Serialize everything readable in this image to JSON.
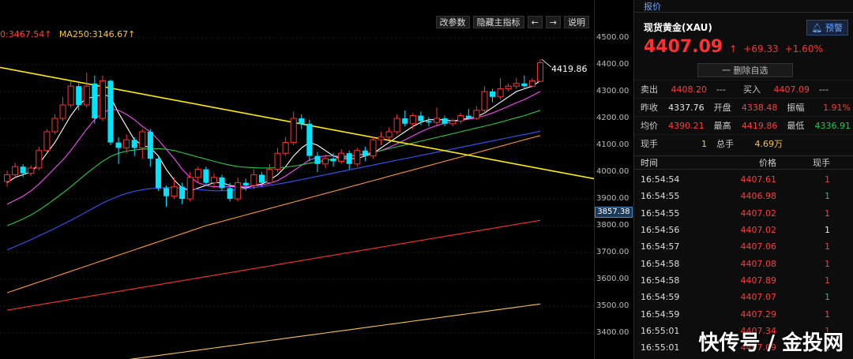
{
  "chart": {
    "ma_legend": [
      {
        "label": "0:3467.54↑",
        "color": "#ff4040"
      },
      {
        "label": "MA250:3146.67↑",
        "color": "#f5c542"
      }
    ],
    "toolbar": {
      "edit_params": "改参数",
      "hide_main": "隐藏主指标",
      "prev": "←",
      "next": "→",
      "help": "说明"
    },
    "high_label": "4419.86",
    "current_price_tag": "3857.38",
    "axis_ticks": [
      "4500.00",
      "4400.00",
      "4300.00",
      "4200.00",
      "4100.00",
      "4000.00",
      "3900.00",
      "3800.00",
      "3700.00",
      "3600.00",
      "3500.00",
      "3400.00"
    ]
  },
  "chart_data": {
    "type": "candlestick",
    "y_range": [
      3360,
      4520
    ],
    "candles": [
      {
        "o": 3965,
        "c": 3990,
        "h": 4005,
        "l": 3945
      },
      {
        "o": 3990,
        "c": 4020,
        "h": 4035,
        "l": 3975
      },
      {
        "o": 4020,
        "c": 3995,
        "h": 4030,
        "l": 3980
      },
      {
        "o": 3995,
        "c": 4015,
        "h": 4025,
        "l": 3985
      },
      {
        "o": 4015,
        "c": 4080,
        "h": 4095,
        "l": 4005
      },
      {
        "o": 4080,
        "c": 4150,
        "h": 4160,
        "l": 4070
      },
      {
        "o": 4150,
        "c": 4200,
        "h": 4215,
        "l": 4140
      },
      {
        "o": 4200,
        "c": 4250,
        "h": 4280,
        "l": 4190
      },
      {
        "o": 4250,
        "c": 4320,
        "h": 4340,
        "l": 4240
      },
      {
        "o": 4320,
        "c": 4250,
        "h": 4330,
        "l": 4230
      },
      {
        "o": 4250,
        "c": 4320,
        "h": 4370,
        "l": 4240
      },
      {
        "o": 4330,
        "c": 4200,
        "h": 4360,
        "l": 4180
      },
      {
        "o": 4200,
        "c": 4340,
        "h": 4360,
        "l": 4190
      },
      {
        "o": 4340,
        "c": 4110,
        "h": 4345,
        "l": 4100
      },
      {
        "o": 4110,
        "c": 4090,
        "h": 4130,
        "l": 4030
      },
      {
        "o": 4090,
        "c": 4120,
        "h": 4140,
        "l": 4070
      },
      {
        "o": 4120,
        "c": 4090,
        "h": 4130,
        "l": 4060
      },
      {
        "o": 4090,
        "c": 4150,
        "h": 4160,
        "l": 4050
      },
      {
        "o": 4150,
        "c": 4050,
        "h": 4160,
        "l": 4020
      },
      {
        "o": 4050,
        "c": 3940,
        "h": 4060,
        "l": 3930
      },
      {
        "o": 3940,
        "c": 3910,
        "h": 3950,
        "l": 3870
      },
      {
        "o": 3910,
        "c": 3945,
        "h": 3980,
        "l": 3900
      },
      {
        "o": 3945,
        "c": 3900,
        "h": 3960,
        "l": 3880
      },
      {
        "o": 3900,
        "c": 3980,
        "h": 4000,
        "l": 3890
      },
      {
        "o": 3980,
        "c": 4010,
        "h": 4020,
        "l": 3960
      },
      {
        "o": 4010,
        "c": 3960,
        "h": 4020,
        "l": 3950
      },
      {
        "o": 3960,
        "c": 3980,
        "h": 3995,
        "l": 3940
      },
      {
        "o": 3980,
        "c": 3940,
        "h": 3990,
        "l": 3930
      },
      {
        "o": 3940,
        "c": 3900,
        "h": 3960,
        "l": 3890
      },
      {
        "o": 3900,
        "c": 3960,
        "h": 3980,
        "l": 3890
      },
      {
        "o": 3960,
        "c": 3950,
        "h": 3975,
        "l": 3930
      },
      {
        "o": 3950,
        "c": 3990,
        "h": 4010,
        "l": 3935
      },
      {
        "o": 3990,
        "c": 3960,
        "h": 4000,
        "l": 3945
      },
      {
        "o": 3960,
        "c": 4010,
        "h": 4030,
        "l": 3955
      },
      {
        "o": 4010,
        "c": 4070,
        "h": 4090,
        "l": 4000
      },
      {
        "o": 4070,
        "c": 4110,
        "h": 4130,
        "l": 4060
      },
      {
        "o": 4110,
        "c": 4200,
        "h": 4225,
        "l": 4100
      },
      {
        "o": 4200,
        "c": 4180,
        "h": 4215,
        "l": 4160
      },
      {
        "o": 4180,
        "c": 4060,
        "h": 4195,
        "l": 4040
      },
      {
        "o": 4060,
        "c": 4030,
        "h": 4075,
        "l": 4000
      },
      {
        "o": 4030,
        "c": 4050,
        "h": 4065,
        "l": 4015
      },
      {
        "o": 4050,
        "c": 4040,
        "h": 4070,
        "l": 4020
      },
      {
        "o": 4040,
        "c": 4070,
        "h": 4085,
        "l": 4030
      },
      {
        "o": 4070,
        "c": 4030,
        "h": 4080,
        "l": 4010
      },
      {
        "o": 4030,
        "c": 4080,
        "h": 4090,
        "l": 4020
      },
      {
        "o": 4080,
        "c": 4060,
        "h": 4095,
        "l": 4040
      },
      {
        "o": 4060,
        "c": 4120,
        "h": 4130,
        "l": 4050
      },
      {
        "o": 4120,
        "c": 4130,
        "h": 4150,
        "l": 4100
      },
      {
        "o": 4130,
        "c": 4150,
        "h": 4165,
        "l": 4120
      },
      {
        "o": 4150,
        "c": 4200,
        "h": 4215,
        "l": 4140
      },
      {
        "o": 4200,
        "c": 4180,
        "h": 4230,
        "l": 4170
      },
      {
        "o": 4180,
        "c": 4210,
        "h": 4220,
        "l": 4160
      },
      {
        "o": 4210,
        "c": 4190,
        "h": 4225,
        "l": 4175
      },
      {
        "o": 4190,
        "c": 4185,
        "h": 4205,
        "l": 4170
      },
      {
        "o": 4185,
        "c": 4200,
        "h": 4240,
        "l": 4175
      },
      {
        "o": 4200,
        "c": 4180,
        "h": 4210,
        "l": 4170
      },
      {
        "o": 4180,
        "c": 4190,
        "h": 4200,
        "l": 4170
      },
      {
        "o": 4190,
        "c": 4210,
        "h": 4220,
        "l": 4180
      },
      {
        "o": 4210,
        "c": 4200,
        "h": 4235,
        "l": 4195
      },
      {
        "o": 4200,
        "c": 4230,
        "h": 4245,
        "l": 4195
      },
      {
        "o": 4230,
        "c": 4300,
        "h": 4320,
        "l": 4220
      },
      {
        "o": 4300,
        "c": 4280,
        "h": 4310,
        "l": 4260
      },
      {
        "o": 4280,
        "c": 4310,
        "h": 4350,
        "l": 4270
      },
      {
        "o": 4310,
        "c": 4320,
        "h": 4330,
        "l": 4300
      },
      {
        "o": 4320,
        "c": 4330,
        "h": 4350,
        "l": 4310
      },
      {
        "o": 4330,
        "c": 4320,
        "h": 4360,
        "l": 4310
      },
      {
        "o": 4320,
        "c": 4340,
        "h": 4350,
        "l": 4315
      },
      {
        "o": 4338,
        "c": 4407,
        "h": 4420,
        "l": 4337
      }
    ],
    "ma_lines": [
      {
        "name": "MA5",
        "color": "#ffffff",
        "values": [
          3960,
          3980,
          3990,
          4000,
          4030,
          4070,
          4110,
          4160,
          4210,
          4250,
          4275,
          4280,
          4290,
          4280,
          4220,
          4170,
          4120,
          4100,
          4090,
          4060,
          4010,
          3970,
          3940,
          3930,
          3940,
          3950,
          3960,
          3960,
          3950,
          3945,
          3940,
          3950,
          3955,
          3970,
          3990,
          4020,
          4060,
          4090,
          4110,
          4100,
          4080,
          4060,
          4050,
          4050,
          4050,
          4060,
          4070,
          4090,
          4110,
          4130,
          4150,
          4170,
          4185,
          4195,
          4195,
          4195,
          4190,
          4195,
          4200,
          4205,
          4220,
          4240,
          4260,
          4280,
          4300,
          4310,
          4320,
          4340
        ]
      },
      {
        "name": "MA10",
        "color": "#ff44ff",
        "values": [
          3880,
          3895,
          3910,
          3930,
          3955,
          3985,
          4015,
          4045,
          4080,
          4120,
          4160,
          4195,
          4220,
          4235,
          4230,
          4215,
          4195,
          4170,
          4150,
          4120,
          4085,
          4050,
          4010,
          3980,
          3960,
          3950,
          3945,
          3945,
          3945,
          3945,
          3945,
          3948,
          3952,
          3958,
          3968,
          3985,
          4005,
          4025,
          4045,
          4055,
          4060,
          4060,
          4058,
          4060,
          4062,
          4066,
          4072,
          4080,
          4092,
          4105,
          4120,
          4135,
          4150,
          4163,
          4173,
          4182,
          4188,
          4192,
          4197,
          4202,
          4210,
          4220,
          4232,
          4245,
          4258,
          4270,
          4285,
          4300
        ]
      },
      {
        "name": "MA20",
        "color": "#22cc44",
        "values": [
          3800,
          3812,
          3825,
          3840,
          3858,
          3878,
          3900,
          3922,
          3945,
          3970,
          3995,
          4018,
          4040,
          4058,
          4070,
          4078,
          4082,
          4085,
          4087,
          4087,
          4085,
          4080,
          4072,
          4064,
          4056,
          4048,
          4040,
          4032,
          4026,
          4020,
          4018,
          4016,
          4015,
          4015,
          4016,
          4018,
          4022,
          4027,
          4033,
          4038,
          4043,
          4048,
          4053,
          4058,
          4063,
          4068,
          4074,
          4080,
          4087,
          4094,
          4101,
          4108,
          4115,
          4122,
          4129,
          4136,
          4143,
          4150,
          4157,
          4164,
          4171,
          4178,
          4186,
          4194,
          4202,
          4210,
          4220,
          4230
        ]
      },
      {
        "name": "MA30",
        "color": "#3355ff",
        "values": [
          3710,
          3722,
          3735,
          3748,
          3762,
          3776,
          3790,
          3805,
          3820,
          3836,
          3852,
          3868,
          3884,
          3898,
          3910,
          3920,
          3928,
          3934,
          3938,
          3940,
          3942,
          3942,
          3940,
          3938,
          3935,
          3932,
          3930,
          3930,
          3932,
          3935,
          3938,
          3942,
          3946,
          3950,
          3955,
          3960,
          3966,
          3972,
          3978,
          3984,
          3990,
          3996,
          4002,
          4008,
          4014,
          4020,
          4026,
          4032,
          4038,
          4044,
          4050,
          4056,
          4062,
          4068,
          4074,
          4080,
          4086,
          4092,
          4098,
          4104,
          4110,
          4116,
          4122,
          4128,
          4134,
          4140,
          4146,
          4152
        ]
      },
      {
        "name": "MA60",
        "color": "#ff9922",
        "values": [
          3550,
          3560,
          3570,
          3580,
          3590,
          3600,
          3610,
          3620,
          3630,
          3640,
          3650,
          3660,
          3670,
          3680,
          3690,
          3700,
          3710,
          3720,
          3730,
          3740,
          3750,
          3760,
          3770,
          3780,
          3790,
          3800,
          3808,
          3816,
          3824,
          3832,
          3840,
          3848,
          3856,
          3864,
          3872,
          3880,
          3888,
          3896,
          3904,
          3912,
          3920,
          3928,
          3936,
          3944,
          3952,
          3960,
          3968,
          3976,
          3984,
          3992,
          4000,
          4008,
          4016,
          4024,
          4032,
          4040,
          4048,
          4056,
          4064,
          4072,
          4080,
          4088,
          4096,
          4104,
          4112,
          4120,
          4128,
          4136
        ]
      },
      {
        "name": "MA120",
        "color": "#ff3030",
        "values": [
          3485,
          3490,
          3495,
          3500,
          3505,
          3510,
          3515,
          3520,
          3525,
          3530,
          3535,
          3540,
          3545,
          3550,
          3555,
          3560,
          3565,
          3570,
          3575,
          3580,
          3585,
          3590,
          3595,
          3600,
          3605,
          3610,
          3615,
          3620,
          3625,
          3630,
          3635,
          3640,
          3645,
          3650,
          3655,
          3660,
          3665,
          3670,
          3675,
          3680,
          3685,
          3690,
          3695,
          3700,
          3705,
          3710,
          3715,
          3720,
          3725,
          3730,
          3735,
          3740,
          3745,
          3750,
          3755,
          3760,
          3765,
          3770,
          3775,
          3780,
          3785,
          3790,
          3795,
          3800,
          3805,
          3810,
          3815,
          3820
        ]
      },
      {
        "name": "MA250",
        "color": "#f5c542",
        "values": [
          3240,
          3244,
          3248,
          3252,
          3256,
          3260,
          3264,
          3268,
          3272,
          3276,
          3280,
          3284,
          3288,
          3292,
          3296,
          3300,
          3304,
          3308,
          3312,
          3316,
          3320,
          3324,
          3328,
          3332,
          3336,
          3340,
          3344,
          3348,
          3352,
          3356,
          3360,
          3364,
          3368,
          3372,
          3376,
          3380,
          3384,
          3388,
          3392,
          3396,
          3400,
          3404,
          3408,
          3412,
          3416,
          3420,
          3424,
          3428,
          3432,
          3436,
          3440,
          3444,
          3448,
          3452,
          3456,
          3460,
          3464,
          3468,
          3472,
          3476,
          3480,
          3484,
          3488,
          3492,
          3496,
          3500,
          3504,
          3508
        ]
      }
    ],
    "trendline": {
      "color": "#ffee00",
      "from": [
        0,
        4390
      ],
      "to": [
        752,
        3975
      ]
    }
  },
  "quote": {
    "tab": "报价",
    "symbol": "现货黄金(XAU)",
    "alert_label": "预警",
    "price": "4407.09",
    "arrow": "↑",
    "change": "+69.33",
    "change_pct": "+1.60%",
    "watch_label": "一 删除自选",
    "rows": [
      [
        {
          "l": "卖出",
          "v": "4408.20",
          "c": "red"
        },
        {
          "l": "---",
          "v": "",
          "c": "white"
        },
        {
          "l": "买入",
          "v": "4407.09",
          "c": "red"
        },
        {
          "l": "---",
          "v": "",
          "c": "white"
        }
      ],
      [
        {
          "l": "昨收",
          "v": "4337.76",
          "c": "white"
        },
        {
          "l": "开盘",
          "v": "4338.48",
          "c": "red"
        },
        {
          "l": "振幅",
          "v": "1.91%",
          "c": "red"
        }
      ],
      [
        {
          "l": "均价",
          "v": "4390.21",
          "c": "red"
        },
        {
          "l": "最高",
          "v": "4419.86",
          "c": "red"
        },
        {
          "l": "最低",
          "v": "4336.91",
          "c": "green"
        }
      ],
      [
        {
          "l": "现手",
          "v": "1",
          "c": "yellow"
        },
        {
          "l": "总手",
          "v": "4.69万",
          "c": "yellow"
        }
      ]
    ],
    "ticks_header": {
      "time": "时间",
      "price": "价格",
      "vol": "现手"
    },
    "ticks": [
      {
        "time": "16:54:54",
        "price": "4407.61",
        "vol": "1",
        "vc": "red"
      },
      {
        "time": "16:54:55",
        "price": "4406.98",
        "vol": "1",
        "vc": "green"
      },
      {
        "time": "16:54:55",
        "price": "4407.02",
        "vol": "1",
        "vc": "red"
      },
      {
        "time": "16:54:56",
        "price": "4407.02",
        "vol": "1",
        "vc": "white"
      },
      {
        "time": "16:54:57",
        "price": "4407.06",
        "vol": "1",
        "vc": "red"
      },
      {
        "time": "16:54:58",
        "price": "4407.08",
        "vol": "1",
        "vc": "red"
      },
      {
        "time": "16:54:58",
        "price": "4407.89",
        "vol": "1",
        "vc": "red"
      },
      {
        "time": "16:54:59",
        "price": "4407.07",
        "vol": "1",
        "vc": "green"
      },
      {
        "time": "16:54:59",
        "price": "4407.29",
        "vol": "1",
        "vc": "red"
      },
      {
        "time": "16:55:01",
        "price": "4407.34",
        "vol": "1",
        "vc": "red"
      },
      {
        "time": "16:55:01",
        "price": "4407.09",
        "vol": "1",
        "vc": "green"
      }
    ]
  },
  "watermark": "快传号 / 金投网"
}
